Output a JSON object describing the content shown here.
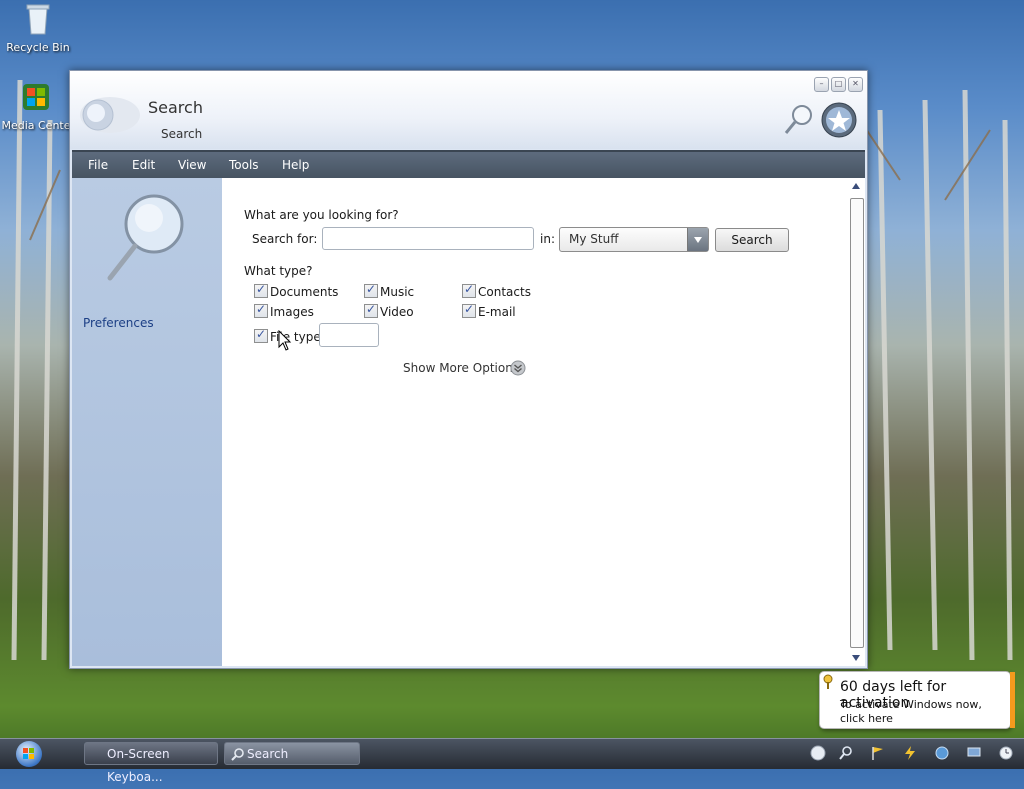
{
  "desktop": {
    "icons": [
      {
        "label": "Recycle Bin"
      },
      {
        "label": "Media Cente"
      }
    ]
  },
  "window": {
    "title": "Search",
    "subtitle": "Search",
    "menu": [
      "File",
      "Edit",
      "View",
      "Tools",
      "Help"
    ],
    "sidebar": {
      "preferences_label": "Preferences"
    },
    "form": {
      "question": "What are you looking for?",
      "search_for_label": "Search for:",
      "search_for_value": "",
      "in_label": "in:",
      "location_value": "My Stuff",
      "search_button": "Search",
      "what_type_label": "What type?",
      "types": [
        {
          "label": "Documents",
          "checked": true
        },
        {
          "label": "Music",
          "checked": true
        },
        {
          "label": "Contacts",
          "checked": true
        },
        {
          "label": "Images",
          "checked": true
        },
        {
          "label": "Video",
          "checked": true
        },
        {
          "label": "E-mail",
          "checked": true
        }
      ],
      "file_type": {
        "label": "File type:",
        "checked": true,
        "value": ""
      },
      "more_options": "Show More Options"
    }
  },
  "taskbar": {
    "buttons": [
      {
        "label": "On-Screen Keyboa..."
      },
      {
        "label": "Search"
      }
    ]
  },
  "notification": {
    "title": "60 days left for activation",
    "body": "To activate Windows now, click here"
  },
  "colors": {
    "menubar": "#4f5c6b",
    "sidebar": "#b3c6e0",
    "accent_orange": "#f49a1d"
  }
}
